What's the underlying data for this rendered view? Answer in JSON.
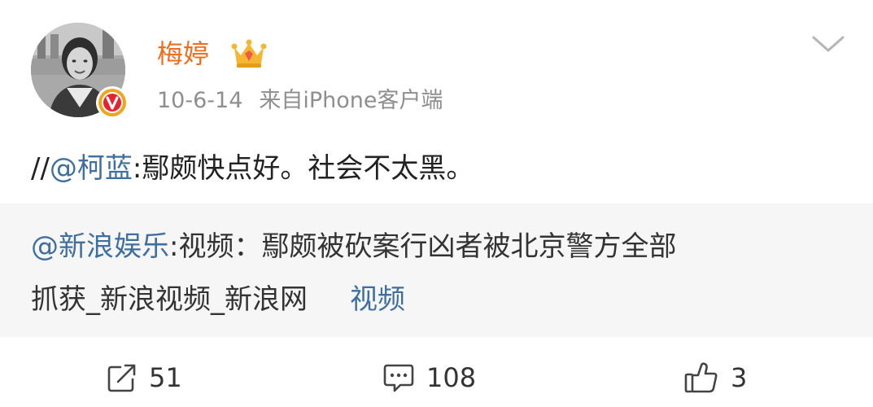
{
  "post": {
    "username": "梅婷",
    "date": "10-6-14",
    "source": "来自iPhone客户端",
    "body": {
      "prefix": "//",
      "mention": "@柯蓝",
      "text": ":鄢颇快点好。社会不太黑。"
    },
    "repost": {
      "mention": "@新浪娱乐",
      "line1_text": ":视频：鄢颇被砍案行凶者被北京警方全部",
      "line2_text": "抓获_新浪视频_新浪网",
      "link_label": "视频"
    },
    "actions": {
      "repost_count": "51",
      "comment_count": "108",
      "like_count": "3"
    },
    "icons": {
      "avatar": "user-avatar-photo",
      "verified": "verified-v-badge-icon",
      "crown": "vip-crown-icon",
      "menu": "chevron-down-icon",
      "repost": "share-icon",
      "comment": "comment-icon",
      "like": "thumbs-up-icon"
    },
    "colors": {
      "username": "#f26c1c",
      "link": "#3f6ea0",
      "verified": "#f0a51a",
      "repost_background": "#f6f6f6"
    }
  }
}
